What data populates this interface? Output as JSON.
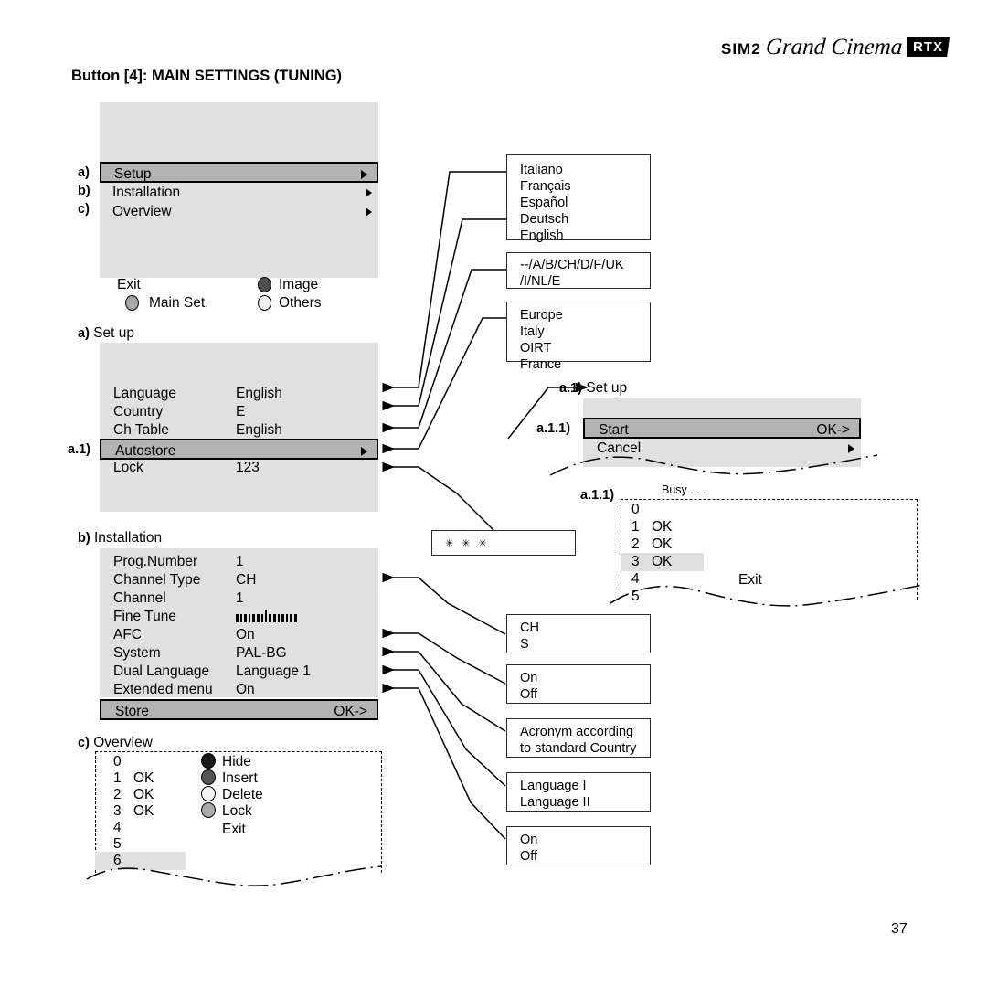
{
  "logo": {
    "brand": "SIM2",
    "model": "Grand Cinema",
    "badge": "RTX"
  },
  "page_title": "Button [4]: MAIN SETTINGS (TUNING)",
  "page_number": "37",
  "main_menu": {
    "items": [
      {
        "mark": "a)",
        "label": "Setup",
        "arrow": "▶",
        "selected": true
      },
      {
        "mark": "b)",
        "label": "Installation",
        "arrow": "▶",
        "selected": false
      },
      {
        "mark": "c)",
        "label": "Overview",
        "arrow": "▶",
        "selected": false
      }
    ],
    "legend": [
      {
        "label": "Exit",
        "fill": "none"
      },
      {
        "label": "Image",
        "fill": "#4d4d4d"
      },
      {
        "label": "Main Set.",
        "fill": "#a6a6a6"
      },
      {
        "label": "Others",
        "fill": "#f0f0f0"
      }
    ]
  },
  "setup_panel": {
    "mark": "a)",
    "title": "Set up",
    "rows": [
      {
        "label": "Language",
        "value": "English",
        "selected": false
      },
      {
        "label": "Country",
        "value": "E",
        "selected": false
      },
      {
        "label": "Ch Table",
        "value": "English",
        "selected": false
      },
      {
        "label": "Autostore",
        "value": "",
        "mark": "a.1)",
        "arrow": "▶",
        "selected": true
      },
      {
        "label": "Lock",
        "value": "123",
        "selected": false
      }
    ]
  },
  "installation_panel": {
    "mark": "b)",
    "title": "Installation",
    "rows": [
      {
        "label": "Prog.Number",
        "value": "1"
      },
      {
        "label": "Channel Type",
        "value": "CH"
      },
      {
        "label": "Channel",
        "value": "1"
      },
      {
        "label": "Fine Tune",
        "value": "",
        "bar": true
      },
      {
        "label": "AFC",
        "value": "On"
      },
      {
        "label": "System",
        "value": "PAL-BG"
      },
      {
        "label": "Dual Language",
        "value": "Language 1"
      },
      {
        "label": "Extended menu",
        "value": "On"
      }
    ],
    "store": {
      "label": "Store",
      "value": "OK->"
    }
  },
  "overview_panel": {
    "mark": "c)",
    "title": "Overview",
    "rows": [
      {
        "num": "0",
        "status": "",
        "selected": false
      },
      {
        "num": "1",
        "status": "OK",
        "selected": false
      },
      {
        "num": "2",
        "status": "OK",
        "selected": false
      },
      {
        "num": "3",
        "status": "OK",
        "selected": false
      },
      {
        "num": "4",
        "status": "",
        "selected": false
      },
      {
        "num": "5",
        "status": "",
        "selected": false
      },
      {
        "num": "6",
        "status": "",
        "selected": true
      }
    ],
    "actions": [
      {
        "label": "Hide",
        "fill": "#1a1a1a"
      },
      {
        "label": "Insert",
        "fill": "#555555"
      },
      {
        "label": "Delete",
        "fill": "#f2f2f2"
      },
      {
        "label": "Lock",
        "fill": "#aaaaaa"
      }
    ],
    "exit_label": "Exit"
  },
  "autostore_panel": {
    "mark": "a.1)",
    "title": "Set up",
    "sub_mark": "a.1.1)",
    "rows": [
      {
        "label": "Start",
        "value": "OK->",
        "selected": true
      },
      {
        "label": "Cancel",
        "value": "",
        "arrow": "▶",
        "selected": false
      }
    ]
  },
  "busy_panel": {
    "mark": "a.1.1)",
    "status": "Busy . . .",
    "exit_label": "Exit",
    "rows": [
      {
        "num": "0",
        "status": "",
        "selected": false
      },
      {
        "num": "1",
        "status": "OK",
        "selected": false
      },
      {
        "num": "2",
        "status": "OK",
        "selected": false
      },
      {
        "num": "3",
        "status": "OK",
        "selected": true
      },
      {
        "num": "4",
        "status": "",
        "selected": false
      },
      {
        "num": "5",
        "status": "",
        "selected": false
      }
    ]
  },
  "callouts": {
    "language": {
      "lines": [
        "Italiano",
        "Français",
        "Español",
        "Deutsch",
        "English"
      ]
    },
    "country": {
      "lines": [
        "--/A/B/CH/D/F/UK",
        "/I/NL/E"
      ]
    },
    "chtable": {
      "lines": [
        "Europe",
        "Italy",
        "OIRT",
        "France"
      ]
    },
    "lock": {
      "lines": [
        "✳ ✳ ✳"
      ]
    },
    "chtype": {
      "lines": [
        "CH",
        "S"
      ]
    },
    "afc": {
      "lines": [
        "On",
        "Off"
      ]
    },
    "system": {
      "lines": [
        "Acronym according",
        "to standard Country"
      ]
    },
    "duallang": {
      "lines": [
        "Language I",
        "Language II"
      ]
    },
    "extmenu": {
      "lines": [
        "On",
        "Off"
      ]
    }
  }
}
